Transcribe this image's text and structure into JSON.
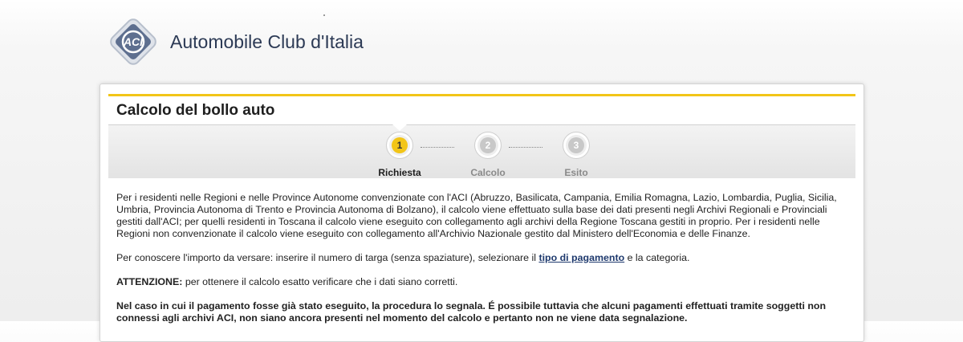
{
  "header": {
    "logo_icon": "aci-logo-icon",
    "logo_text": "Automobile Club d'Italia"
  },
  "colors": {
    "accent_yellow": "#f2c518",
    "link_blue": "#1f3a6e"
  },
  "card": {
    "title": "Calcolo del bollo auto"
  },
  "steps": [
    {
      "number": "1",
      "label": "Richiesta",
      "active": true
    },
    {
      "number": "2",
      "label": "Calcolo",
      "active": false
    },
    {
      "number": "3",
      "label": "Esito",
      "active": false
    }
  ],
  "content": {
    "para1": "Per i residenti nelle Regioni e nelle Province Autonome convenzionate con l'ACI (Abruzzo, Basilicata, Campania, Emilia Romagna, Lazio, Lombardia, Puglia, Sicilia, Umbria, Provincia Autonoma di Trento e Provincia Autonoma di Bolzano), il calcolo viene effettuato sulla base dei dati presenti negli Archivi Regionali e Provinciali gestiti dall'ACI; per quelli residenti in Toscana il calcolo viene eseguito con collegamento agli archivi della Regione Toscana gestiti in proprio. Per i residenti nelle Regioni non convenzionate il calcolo viene eseguito con collegamento all'Archivio Nazionale gestito dal Ministero dell'Economia e delle Finanze.",
    "para2_before": "Per conoscere l'importo da versare: inserire il numero di targa (senza spaziature), selezionare il ",
    "para2_link": "tipo di pagamento",
    "para2_after": " e la categoria.",
    "para3_bold": "ATTENZIONE:",
    "para3_rest": " per ottenere il calcolo esatto verificare che i dati siano corretti.",
    "para4": "Nel caso in cui il pagamento fosse già stato eseguito, la procedura lo segnala. É possibile tuttavia che alcuni pagamenti effettuati tramite soggetti non connessi agli archivi ACI, non siano ancora presenti nel momento del calcolo e pertanto non ne viene data segnalazione."
  }
}
